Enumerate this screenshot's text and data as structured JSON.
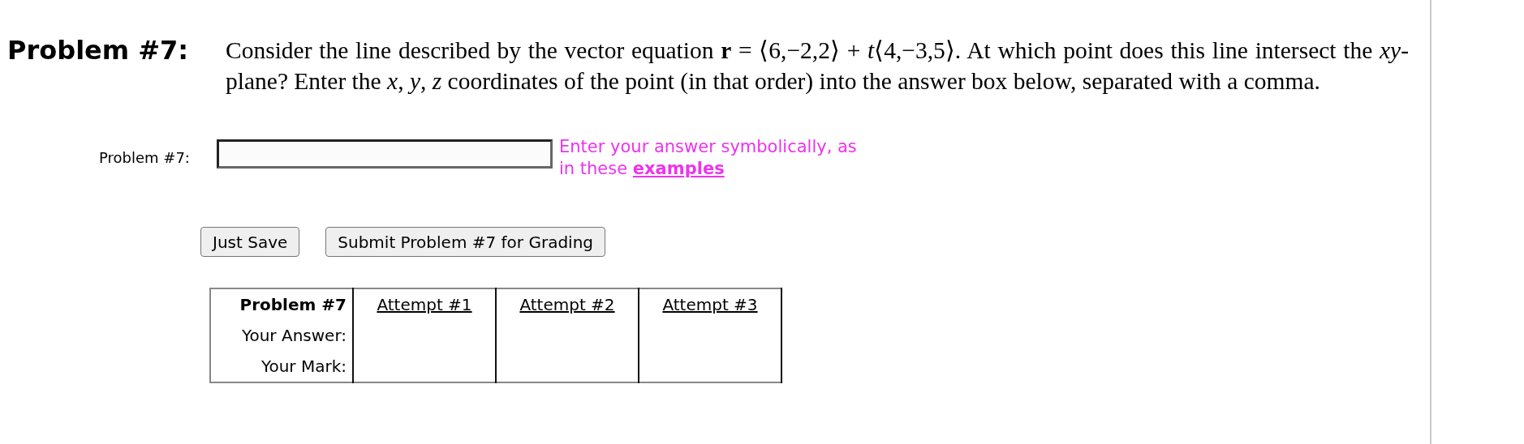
{
  "problem": {
    "title": "Problem #7:",
    "statement": "Consider the line described by the vector equation **r** = ⟨6,−2,2⟩ + *t*⟨4,−3,5⟩. At which point does this line intersect the *xy*-plane? Enter the *x*, *y*, *z* coordinates of the point (in that order) into the answer box below, separated with a comma."
  },
  "answer": {
    "label": "Problem #7:",
    "hint": "Enter your answer symbolically, as in these",
    "hint_link": "examples"
  },
  "buttons": [
    "Just Save",
    "Submit Problem #7 for Grading"
  ],
  "attempts_table": {
    "corner": "Problem #7",
    "columns": [
      "Attempt #1",
      "Attempt #2",
      "Attempt #3"
    ],
    "rows": [
      "Your Answer:",
      "Your Mark:"
    ]
  }
}
